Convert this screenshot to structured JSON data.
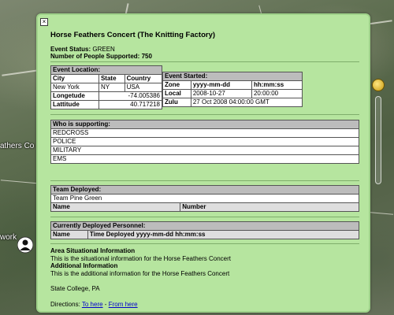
{
  "map": {
    "labels": {
      "work": "work",
      "athers": "athers Co"
    }
  },
  "balloon": {
    "close_glyph": "×",
    "title": "Horse Feathers Concert (The Knitting Factory)",
    "status_label": "Event Status:",
    "status_value": "GREEN",
    "people_label": "Number of People Supported:",
    "people_value": "750",
    "location": {
      "header": "Event Location:",
      "columns": [
        "City",
        "State",
        "Country"
      ],
      "row": [
        "New York",
        "NY",
        "USA"
      ],
      "longitude_label": "Longetude",
      "longitude_value": "-74.005386",
      "latitude_label": "Lattitude",
      "latitude_value": "40.717218"
    },
    "event_started": {
      "header": "Event Started:",
      "columns": [
        "Zone",
        "yyyy-mm-dd",
        "hh:mm:ss"
      ],
      "local": [
        "Local",
        "2008-10-27",
        "20:00:00"
      ],
      "zulu_label": "Zulu",
      "zulu_value": "27 Oct 2008 04:00:00 GMT"
    },
    "supporting": {
      "header": "Who is supporting:",
      "rows": [
        "REDCROSS",
        "POLICE",
        "MILITARY",
        "EMS"
      ]
    },
    "team": {
      "header": "Team Deployed:",
      "value": "Team Pine Green",
      "columns": [
        "Name",
        "Number"
      ]
    },
    "personnel": {
      "header": "Currently Deployed Personnel:",
      "columns": [
        "Name",
        "Time Deployed yyyy-mm-dd hh:mm:ss"
      ]
    },
    "area": {
      "situational_title": "Area Situational Information",
      "situational_text": "This is the situational information for the Horse Feathers Concert",
      "additional_title": "Additional Information",
      "additional_text": "This is the additional information for the Horse Feathers Concert",
      "address": "State College, PA",
      "directions_label": "Directions:",
      "to_here": "To here",
      "separator": "-",
      "from_here": "From here"
    }
  }
}
